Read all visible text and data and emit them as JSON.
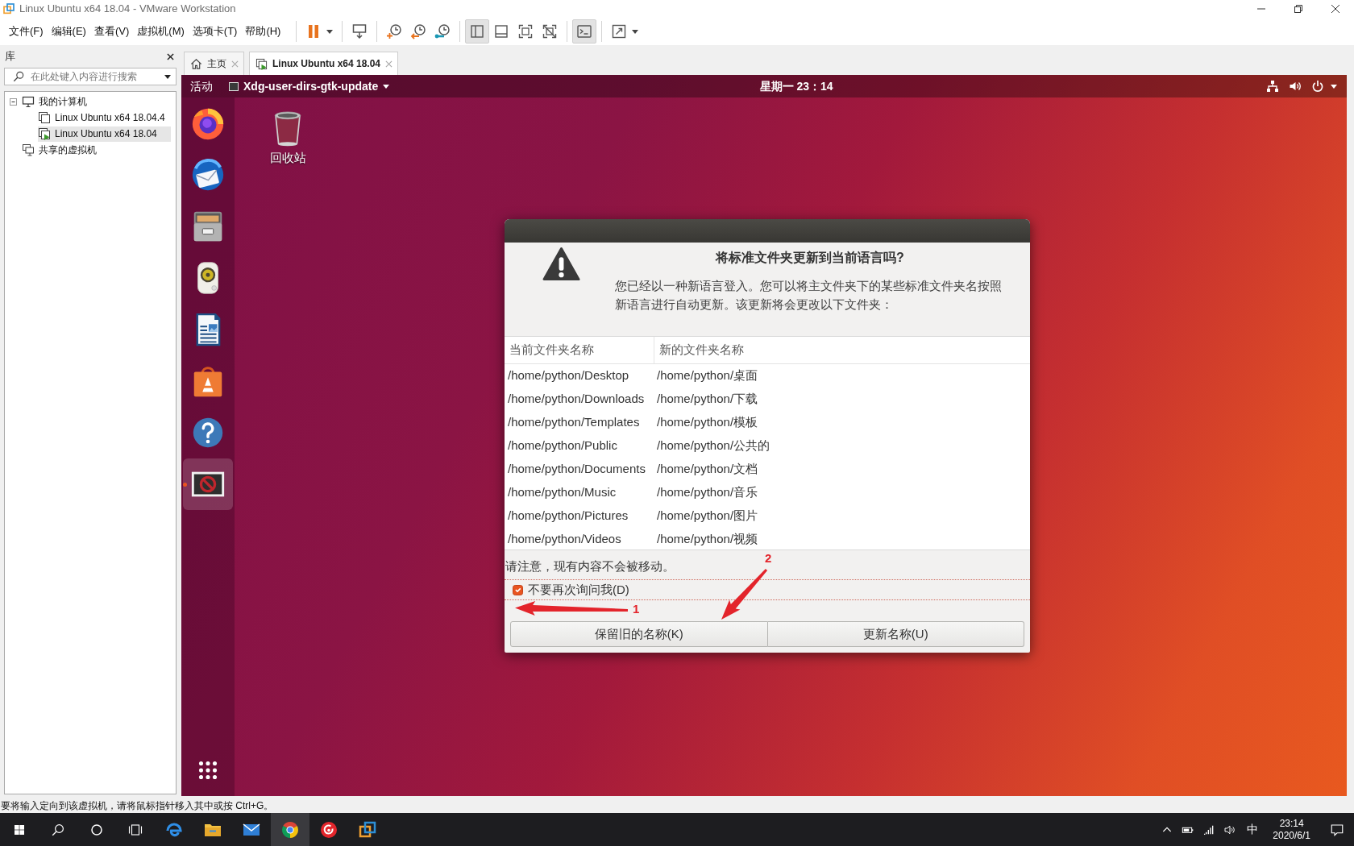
{
  "window": {
    "title": "Linux Ubuntu x64 18.04 - VMware Workstation"
  },
  "menu": [
    "文件(F)",
    "编辑(E)",
    "查看(V)",
    "虚拟机(M)",
    "选项卡(T)",
    "帮助(H)"
  ],
  "toolbar": [
    {
      "buttons": [
        {
          "kind": "pause",
          "pressed": false,
          "menu": true
        }
      ]
    },
    {
      "buttons": [
        {
          "kind": "send-keys",
          "pressed": false,
          "menu": false
        }
      ]
    },
    {
      "buttons": [
        {
          "kind": "snapshot",
          "pressed": false,
          "menu": false
        },
        {
          "kind": "revert",
          "pressed": false,
          "menu": false
        },
        {
          "kind": "snapshot-manager",
          "pressed": false,
          "menu": false
        }
      ]
    },
    {
      "buttons": [
        {
          "kind": "library",
          "pressed": true,
          "menu": false
        },
        {
          "kind": "thumbnails",
          "pressed": false,
          "menu": false
        },
        {
          "kind": "fullscreen",
          "pressed": false,
          "menu": false
        },
        {
          "kind": "unity",
          "pressed": false,
          "menu": false
        }
      ]
    },
    {
      "buttons": [
        {
          "kind": "console",
          "pressed": true,
          "menu": false
        }
      ]
    },
    {
      "buttons": [
        {
          "kind": "stretch",
          "pressed": false,
          "menu": true
        }
      ]
    }
  ],
  "library": {
    "title": "库",
    "search": {
      "placeholder": "在此处键入内容进行搜索"
    },
    "tree": [
      {
        "label": "我的计算机",
        "kind": "computer",
        "selected": false,
        "expanded": true,
        "children": [
          {
            "label": "Linux Ubuntu x64 18.04.4",
            "kind": "vm",
            "selected": false,
            "running": false
          },
          {
            "label": "Linux Ubuntu x64 18.04",
            "kind": "vm",
            "selected": true,
            "running": true
          }
        ]
      },
      {
        "label": "共享的虚拟机",
        "kind": "shared",
        "selected": false
      }
    ]
  },
  "tabs": [
    {
      "label": "主页",
      "kind": "home",
      "selected": false
    },
    {
      "label": "Linux Ubuntu x64 18.04",
      "kind": "vm",
      "selected": true
    }
  ],
  "guest": {
    "top_bar": {
      "activities": "活动",
      "app_menu": "Xdg-user-dirs-gtk-update",
      "clock": "星期一 23：14"
    },
    "dock": [
      {
        "kind": "browser",
        "selected": false,
        "running": false
      },
      {
        "kind": "mail",
        "selected": false,
        "running": false
      },
      {
        "kind": "files",
        "selected": false,
        "running": false
      },
      {
        "kind": "music",
        "selected": false,
        "running": false
      },
      {
        "kind": "writer",
        "selected": false,
        "running": false
      },
      {
        "kind": "software",
        "selected": false,
        "running": false
      },
      {
        "kind": "help",
        "selected": false,
        "running": false
      },
      {
        "kind": "blocked-app",
        "selected": true,
        "running": true
      },
      {
        "kind": "apps",
        "selected": false,
        "running": false
      }
    ],
    "desktop_icons": [
      {
        "label": "回收站",
        "kind": "trash"
      }
    ],
    "dialog": {
      "title": "将标准文件夹更新到当前语言吗?",
      "message": "您已经以一种新语言登入。您可以将主文件夹下的某些标准文件夹名按照新语言进行自动更新。该更新将会更改以下文件夹：",
      "columns": [
        "当前文件夹名称",
        "新的文件夹名称"
      ],
      "rows": [
        [
          "/home/python/Desktop",
          "/home/python/桌面"
        ],
        [
          "/home/python/Downloads",
          "/home/python/下载"
        ],
        [
          "/home/python/Templates",
          "/home/python/模板"
        ],
        [
          "/home/python/Public",
          "/home/python/公共的"
        ],
        [
          "/home/python/Documents",
          "/home/python/文档"
        ],
        [
          "/home/python/Music",
          "/home/python/音乐"
        ],
        [
          "/home/python/Pictures",
          "/home/python/图片"
        ],
        [
          "/home/python/Videos",
          "/home/python/视频"
        ]
      ],
      "note": "请注意，现有内容不会被移动。",
      "checkbox": {
        "label": "不要再次询问我(D)",
        "checked": true,
        "focused": true
      },
      "buttons": [
        "保留旧的名称(K)",
        "更新名称(U)"
      ]
    },
    "annotations": [
      {
        "label": "1",
        "color": "#e3242b",
        "kind": "checkbox"
      },
      {
        "label": "2",
        "color": "#e3242b",
        "kind": "button"
      }
    ]
  },
  "status_bar": {
    "text": "要将输入定向到该虚拟机，请将鼠标指针移入其中或按 Ctrl+G。"
  },
  "taskbar": {
    "buttons": [
      {
        "kind": "start",
        "selected": false
      },
      {
        "kind": "search",
        "selected": false
      },
      {
        "kind": "assistant",
        "selected": false
      },
      {
        "kind": "task-view",
        "selected": false
      },
      {
        "kind": "edge",
        "selected": false
      },
      {
        "kind": "explorer",
        "selected": false
      },
      {
        "kind": "mail",
        "selected": false
      },
      {
        "kind": "chrome",
        "selected": true
      },
      {
        "kind": "music",
        "selected": false
      },
      {
        "kind": "vmware",
        "selected": false
      }
    ],
    "tray": {
      "ime": "中",
      "time": "23:14",
      "date": "2020/6/1"
    }
  }
}
